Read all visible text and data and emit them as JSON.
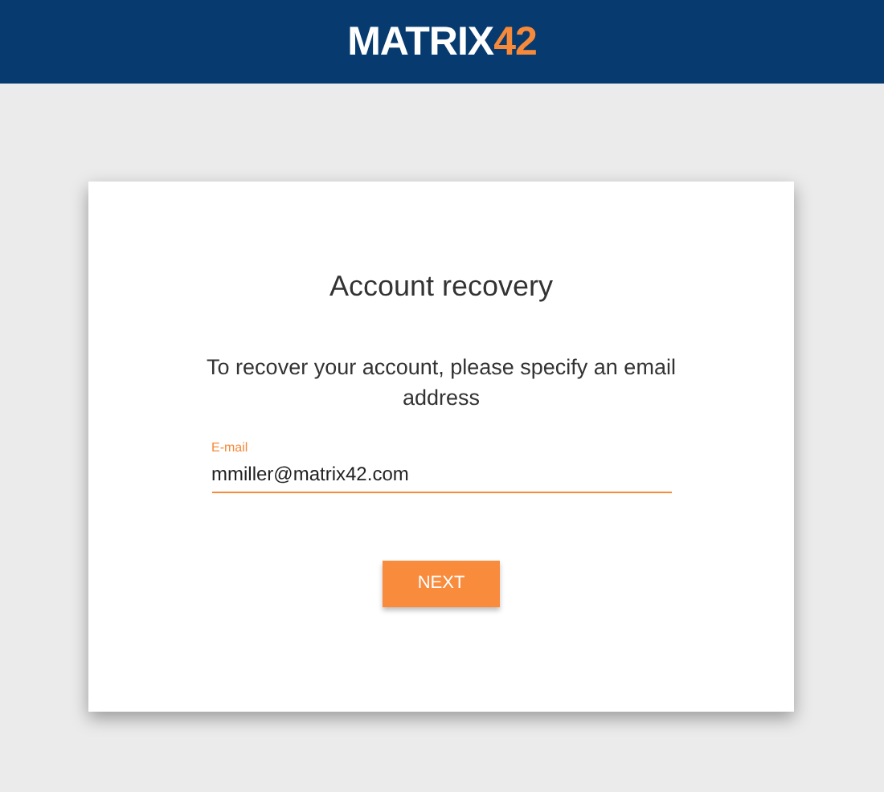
{
  "header": {
    "logo": {
      "word": "MATRIX",
      "number": "42"
    }
  },
  "card": {
    "title": "Account recovery",
    "description": "To recover your account, please specify an email address",
    "email_field": {
      "label": "E-mail",
      "value": "mmiller@matrix42.com"
    },
    "buttons": [
      {
        "label": "NEXT"
      }
    ]
  }
}
